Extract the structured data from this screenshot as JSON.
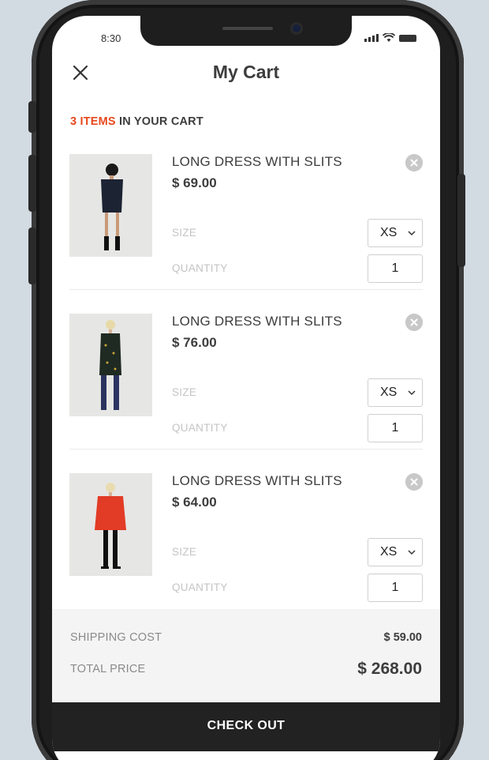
{
  "status_bar": {
    "time": "8:30"
  },
  "header": {
    "title": "My Cart",
    "close_icon": "close-icon"
  },
  "cart_summary_line": {
    "count": "3 ITEMS",
    "suffix": " IN YOUR CART"
  },
  "labels": {
    "size": "SIZE",
    "quantity": "QUANTITY"
  },
  "items": [
    {
      "name": "LONG DRESS WITH SLITS",
      "price": "$ 69.00",
      "size": "XS",
      "quantity": "1",
      "outfit_color": "#1c2333"
    },
    {
      "name": "LONG DRESS WITH SLITS",
      "price": "$ 76.00",
      "size": "XS",
      "quantity": "1",
      "outfit_color": "#1f2a22"
    },
    {
      "name": "LONG DRESS WITH SLITS",
      "price": "$ 64.00",
      "size": "XS",
      "quantity": "1",
      "outfit_color": "#e23b26"
    }
  ],
  "summary": {
    "shipping_label": "SHIPPING COST",
    "shipping_value": "$ 59.00",
    "total_label": "TOTAL PRICE",
    "total_value": "$ 268.00"
  },
  "checkout": {
    "label": "CHECK OUT"
  },
  "colors": {
    "accent": "#e8491d",
    "dark": "#222222",
    "text": "#3d3d3d"
  }
}
